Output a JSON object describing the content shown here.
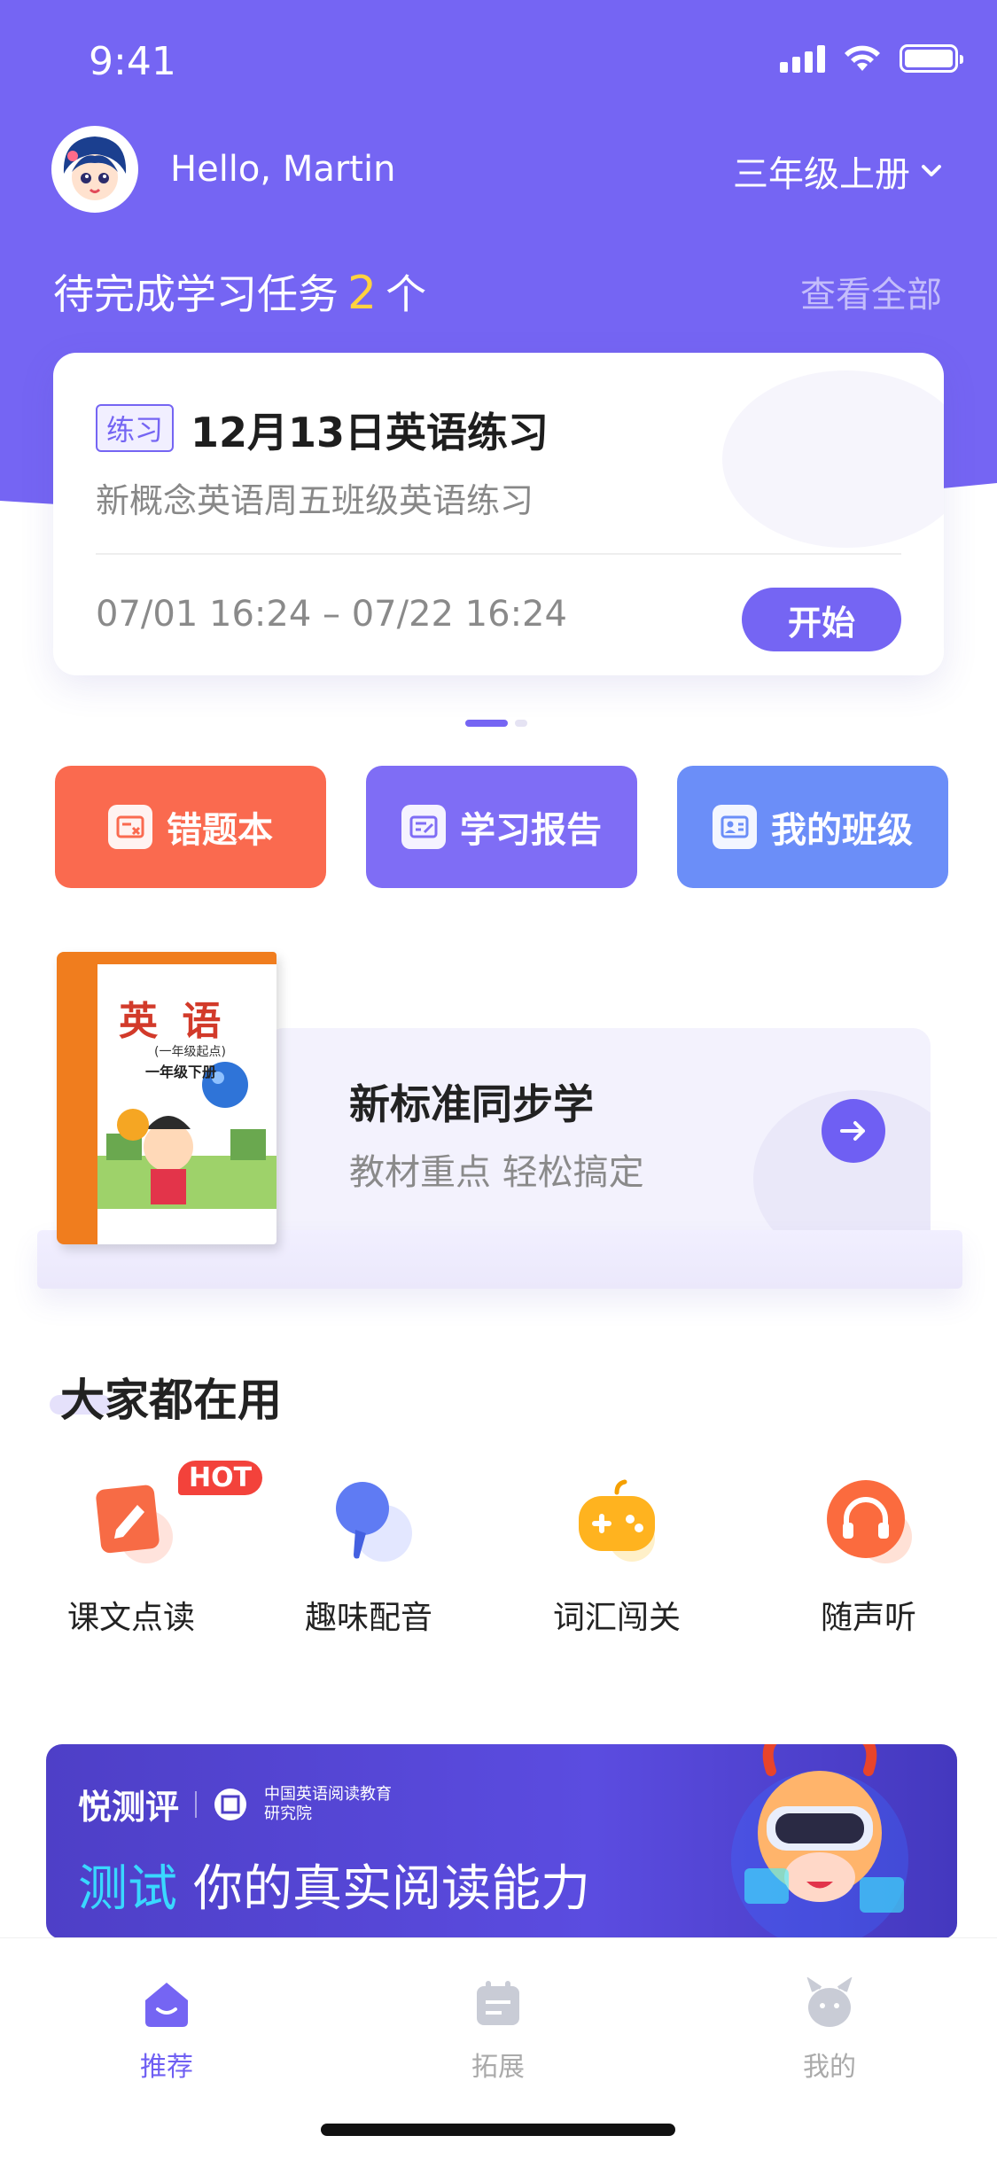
{
  "status_bar": {
    "time": "9:41"
  },
  "user": {
    "greeting": "Hello, Martin",
    "grade": "三年级上册"
  },
  "tasks": {
    "title_prefix": "待完成学习任务",
    "count": "2",
    "title_suffix": "个",
    "view_all": "查看全部",
    "card": {
      "tag": "练习",
      "title": "12月13日英语练习",
      "subtitle": "新概念英语周五班级英语练习",
      "time_range": "07/01 16:24 – 07/22 16:24",
      "start_label": "开始"
    }
  },
  "quick_actions": [
    {
      "label": "错题本",
      "icon": "wrong-book-icon",
      "color": "#fa6a4f"
    },
    {
      "label": "学习报告",
      "icon": "report-icon",
      "color": "#7f6df5"
    },
    {
      "label": "我的班级",
      "icon": "class-icon",
      "color": "#6b8ef8"
    }
  ],
  "textbook": {
    "cover_title": "英 语",
    "cover_sub": "(一年级起点)",
    "cover_grade": "一年级下册",
    "title": "新标准同步学",
    "subtitle": "教材重点 轻松搞定"
  },
  "section": {
    "title": "大家都在用"
  },
  "features": [
    {
      "label": "课文点读",
      "icon": "text-reading-icon",
      "badge": "HOT"
    },
    {
      "label": "趣味配音",
      "icon": "dubbing-icon"
    },
    {
      "label": "词汇闯关",
      "icon": "game-controller-icon"
    },
    {
      "label": "随声听",
      "icon": "headphones-icon"
    }
  ],
  "promo": {
    "brand": "悦测评",
    "org_line1": "中国英语阅读教育",
    "org_line2": "研究院",
    "highlight": "测试",
    "headline": "你的真实阅读能力"
  },
  "tabbar": [
    {
      "label": "推荐",
      "icon": "home-icon",
      "active": true
    },
    {
      "label": "拓展",
      "icon": "calendar-icon",
      "active": false
    },
    {
      "label": "我的",
      "icon": "profile-icon",
      "active": false
    }
  ],
  "colors": {
    "primary": "#7565f3",
    "hot": "#f3423b",
    "accent_yellow": "#ffd23f"
  }
}
